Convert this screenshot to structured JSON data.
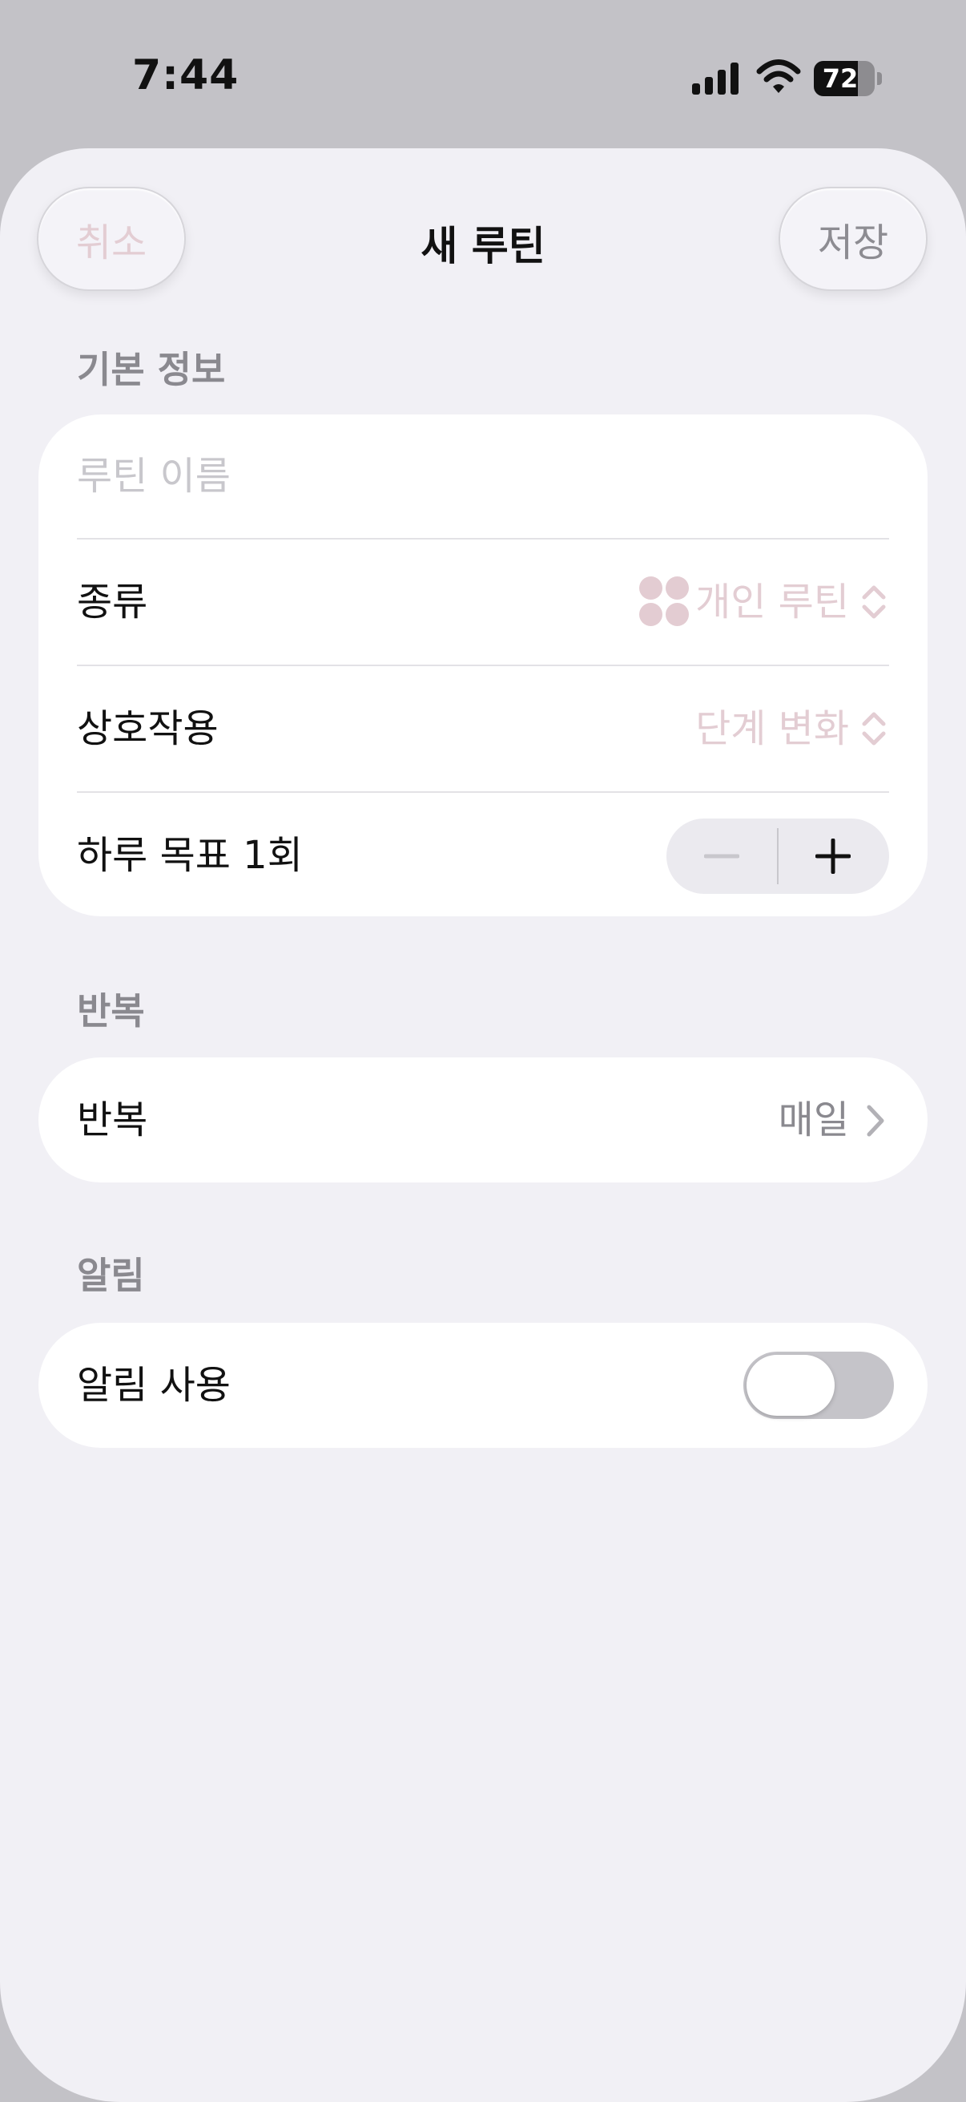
{
  "status_bar": {
    "time": "7:44",
    "battery_level": "72",
    "icons": [
      "cellular-signal-icon",
      "wifi-icon",
      "battery-icon"
    ]
  },
  "nav": {
    "cancel_label": "취소",
    "title": "새 루틴",
    "save_label": "저장"
  },
  "sections": {
    "basic_info": {
      "header": "기본 정보",
      "name_placeholder": "루틴 이름",
      "type_label": "종류",
      "type_value": "개인 루틴",
      "interaction_label": "상호작용",
      "interaction_value": "단계 변화",
      "daily_goal_label": "하루 목표 1회",
      "stepper": {
        "minus_enabled": false,
        "plus_enabled": true
      }
    },
    "repeat": {
      "header": "반복",
      "label": "반복",
      "value": "매일"
    },
    "notification": {
      "header": "알림",
      "label": "알림 사용",
      "enabled": false
    }
  },
  "colors": {
    "accent_disabled": "#e3cdd3",
    "secondary_text": "#8a898f",
    "background": "#f1f0f5",
    "card": "#ffffff"
  }
}
